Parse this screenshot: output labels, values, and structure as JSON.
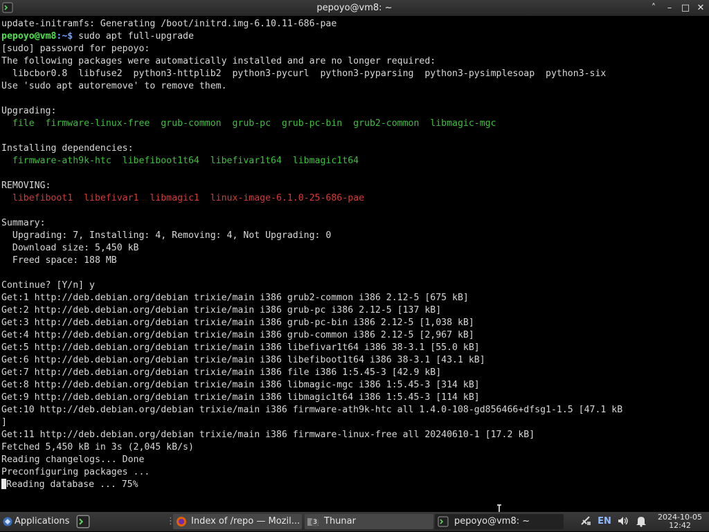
{
  "window": {
    "title": "pepoyo@vm8: ~",
    "buttons": {
      "collapse": "˄",
      "minimize": "–",
      "maximize": "□",
      "close": "✕"
    }
  },
  "terminal": {
    "prompt": {
      "user_host": "pepoyo@vm8",
      "path_sep": ":~$ ",
      "command": "sudo apt full-upgrade"
    },
    "lines": {
      "l1": "update-initramfs: Generating /boot/initrd.img-6.10.11-686-pae",
      "l3": "[sudo] password for pepoyo:",
      "l4": "The following packages were automatically installed and are no longer required:",
      "l5": "  libcbor0.8  libfuse2  python3-httplib2  python3-pycurl  python3-pyparsing  python3-pysimplesoap  python3-six",
      "l6": "Use 'sudo apt autoremove' to remove them.",
      "l8": "Upgrading:",
      "l9": "  file  firmware-linux-free  grub-common  grub-pc  grub-pc-bin  grub2-common  libmagic-mgc",
      "l11": "Installing dependencies:",
      "l12": "  firmware-ath9k-htc  libefiboot1t64  libefivar1t64  libmagic1t64",
      "l14": "REMOVING:",
      "l15": "  libefiboot1  libefivar1  libmagic1  linux-image-6.1.0-25-686-pae",
      "l17": "Summary:",
      "l18": "  Upgrading: 7, Installing: 4, Removing: 4, Not Upgrading: 0",
      "l19": "  Download size: 5,450 kB",
      "l20": "  Freed space: 188 MB",
      "l22": "Continue? [Y/n] y",
      "l23": "Get:1 http://deb.debian.org/debian trixie/main i386 grub2-common i386 2.12-5 [675 kB]",
      "l24": "Get:2 http://deb.debian.org/debian trixie/main i386 grub-pc i386 2.12-5 [137 kB]",
      "l25": "Get:3 http://deb.debian.org/debian trixie/main i386 grub-pc-bin i386 2.12-5 [1,038 kB]",
      "l26": "Get:4 http://deb.debian.org/debian trixie/main i386 grub-common i386 2.12-5 [2,967 kB]",
      "l27": "Get:5 http://deb.debian.org/debian trixie/main i386 libefivar1t64 i386 38-3.1 [55.0 kB]",
      "l28": "Get:6 http://deb.debian.org/debian trixie/main i386 libefiboot1t64 i386 38-3.1 [43.1 kB]",
      "l29": "Get:7 http://deb.debian.org/debian trixie/main i386 file i386 1:5.45-3 [42.9 kB]",
      "l30": "Get:8 http://deb.debian.org/debian trixie/main i386 libmagic-mgc i386 1:5.45-3 [314 kB]",
      "l31": "Get:9 http://deb.debian.org/debian trixie/main i386 libmagic1t64 i386 1:5.45-3 [114 kB]",
      "l32": "Get:10 http://deb.debian.org/debian trixie/main i386 firmware-ath9k-htc all 1.4.0-108-gd856466+dfsg1-1.5 [47.1 kB",
      "l33": "]",
      "l34": "Get:11 http://deb.debian.org/debian trixie/main i386 firmware-linux-free all 20240610-1 [17.2 kB]",
      "l35": "Fetched 5,450 kB in 3s (2,045 kB/s)",
      "l36": "Reading changelogs... Done",
      "l37": "Preconfiguring packages ...",
      "l38": "Reading database ... 75%"
    }
  },
  "taskbar": {
    "menu_label": "Applications",
    "tasks": [
      {
        "label": "Index of /repo — Mozil..."
      },
      {
        "label": "Thunar",
        "badge": "3"
      },
      {
        "label": "pepoyo@vm8: ~"
      }
    ],
    "tray": {
      "language": "EN"
    },
    "clock": {
      "date": "2024-10-05",
      "time": "12:42"
    }
  },
  "colors": {
    "prompt_user": "#4ee04e",
    "upgrade_green": "#3fbf3f",
    "remove_red": "#d23a3a",
    "panel_bg": "#333333"
  }
}
